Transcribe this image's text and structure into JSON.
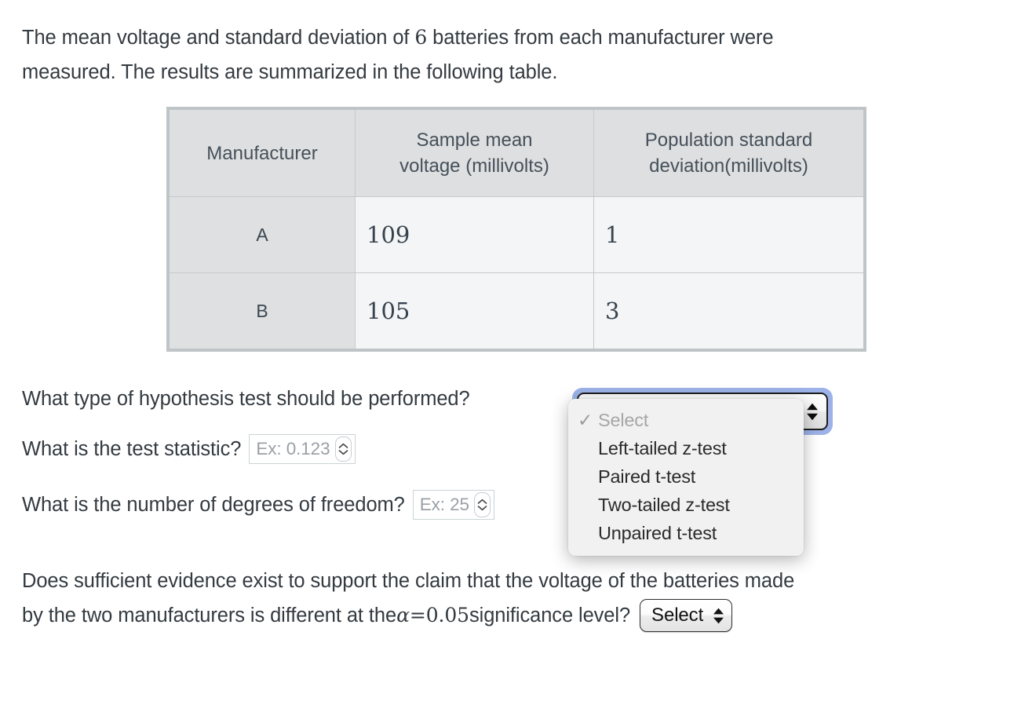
{
  "intro": {
    "line1_a": "The mean voltage and standard deviation of ",
    "sample_size": "6",
    "line1_b": " batteries from each manufacturer were",
    "line2": "measured. The results are summarized in the following table."
  },
  "table": {
    "headers": [
      "Manufacturer",
      "Sample mean voltage (millivolts)",
      "Population standard deviation(millivolts)"
    ],
    "headers_lines": [
      [
        "Manufacturer"
      ],
      [
        "Sample mean",
        "voltage (millivolts)"
      ],
      [
        "Population standard",
        "deviation(millivolts)"
      ]
    ],
    "rows": [
      {
        "manufacturer": "A",
        "sample_mean_voltage": "109",
        "population_sd": "1"
      },
      {
        "manufacturer": "B",
        "sample_mean_voltage": "105",
        "population_sd": "3"
      }
    ]
  },
  "questions": {
    "hypothesis_test": {
      "label": "What type of hypothesis test should be performed?",
      "select_value": "Select"
    },
    "test_statistic": {
      "label": "What is the test statistic?",
      "placeholder": "Ex: 0.123"
    },
    "degrees_of_freedom": {
      "label": "What is the number of degrees of freedom?",
      "placeholder": "Ex: 25"
    },
    "conclusion": {
      "line1": "Does sufficient evidence exist to support the claim that the voltage of the batteries made",
      "line2_a": "by the two manufacturers is different at the ",
      "alpha_symbol": "α",
      "equals": " = ",
      "alpha_value": "0.05",
      "line2_b": " significance level?",
      "select_value": "Select"
    }
  },
  "dropdown": {
    "open": true,
    "selected": "Select",
    "check_glyph": "✓",
    "options": [
      {
        "label": "Select",
        "checked": true,
        "dimmed": true
      },
      {
        "label": "Left-tailed z-test",
        "checked": false,
        "dimmed": false
      },
      {
        "label": "Paired t-test",
        "checked": false,
        "dimmed": false
      },
      {
        "label": "Two-tailed z-test",
        "checked": false,
        "dimmed": false
      },
      {
        "label": "Unpaired t-test",
        "checked": false,
        "dimmed": false
      }
    ]
  },
  "colors": {
    "focus_ring": "#9cb2e8",
    "table_header_bg": "#dedfe0",
    "table_body_bg": "#f4f5f6",
    "table_border": "#bfc4c7",
    "text": "#333a40",
    "placeholder": "#9aa0a6"
  }
}
